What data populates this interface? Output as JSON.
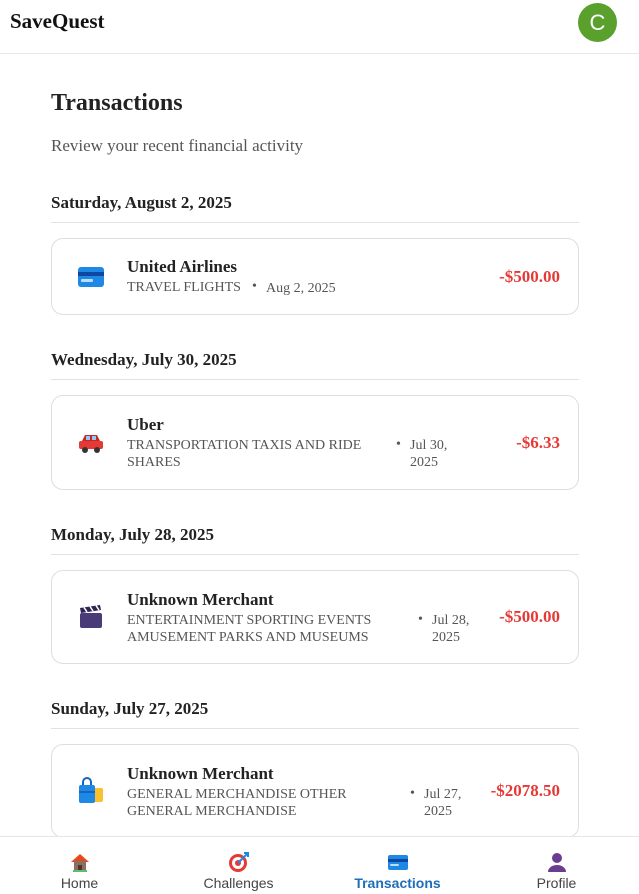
{
  "app": {
    "title": "SaveQuest",
    "avatar_initial": "C",
    "avatar_color": "#5aa02c"
  },
  "page": {
    "title": "Transactions",
    "subtitle": "Review your recent financial activity"
  },
  "groups": [
    {
      "date_header": "Saturday, August 2, 2025",
      "transaction": {
        "merchant": "United Airlines",
        "category": "TRAVEL FLIGHTS",
        "date": "Aug 2, 2025",
        "amount": "-$500.00",
        "icon": "credit-card-icon"
      }
    },
    {
      "date_header": "Wednesday, July 30, 2025",
      "transaction": {
        "merchant": "Uber",
        "category": "TRANSPORTATION TAXIS AND RIDE SHARES",
        "date": "Jul 30, 2025",
        "amount": "-$6.33",
        "icon": "car-icon"
      }
    },
    {
      "date_header": "Monday, July 28, 2025",
      "transaction": {
        "merchant": "Unknown Merchant",
        "category": "ENTERTAINMENT SPORTING EVENTS AMUSEMENT PARKS AND MUSEUMS",
        "date": "Jul 28, 2025",
        "amount": "-$500.00",
        "icon": "clapperboard-icon"
      }
    },
    {
      "date_header": "Sunday, July 27, 2025",
      "transaction": {
        "merchant": "Unknown Merchant",
        "category": "GENERAL MERCHANDISE OTHER GENERAL MERCHANDISE",
        "date": "Jul 27, 2025",
        "amount": "-$2078.50",
        "icon": "shopping-bags-icon"
      }
    }
  ],
  "separator": "•",
  "nav": {
    "items": [
      {
        "label": "Home",
        "icon": "home-icon",
        "active": false
      },
      {
        "label": "Challenges",
        "icon": "target-icon",
        "active": false
      },
      {
        "label": "Transactions",
        "icon": "credit-card-icon",
        "active": true
      },
      {
        "label": "Profile",
        "icon": "person-icon",
        "active": false
      }
    ]
  },
  "colors": {
    "negative_amount": "#e53935",
    "active_nav": "#1e6fb8"
  }
}
